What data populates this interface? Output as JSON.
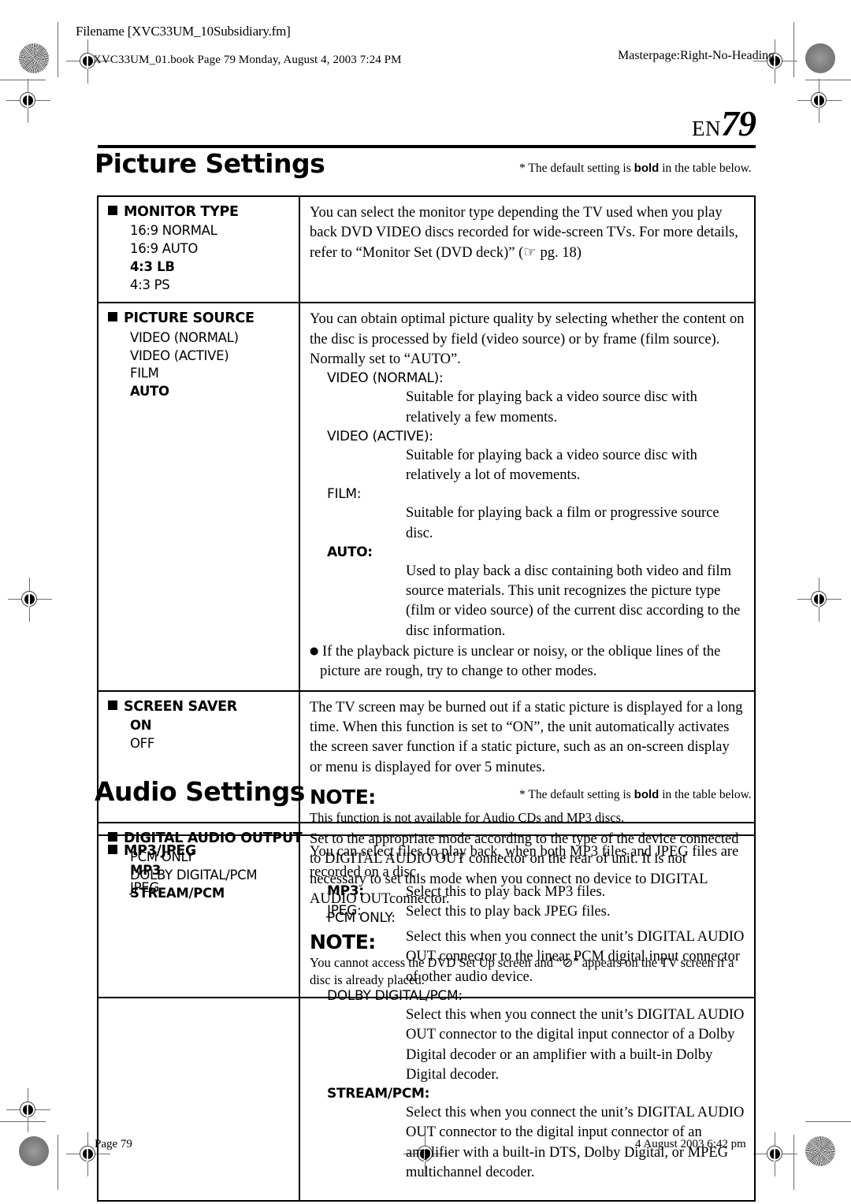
{
  "slugs": {
    "filename": "Filename [XVC33UM_10Subsidiary.fm]",
    "bookline": "XVC33UM_01.book  Page 79  Monday, August 4, 2003  7:24 PM",
    "masterpage": "Masterpage:Right-No-Heading",
    "footer_page": "Page 79",
    "footer_date": "4 August 2003 6:42 pm"
  },
  "header": {
    "locale": "EN",
    "page_number": "79"
  },
  "sections": [
    {
      "id": "picture",
      "title": "Picture Settings",
      "default_note_prefix": "* The default setting is ",
      "default_note_bold": "bold",
      "default_note_suffix": " in the table below."
    },
    {
      "id": "audio",
      "title": "Audio Settings",
      "default_note_prefix": "* The default setting is ",
      "default_note_bold": "bold",
      "default_note_suffix": " in the table below."
    }
  ],
  "picture_table": {
    "monitor_type": {
      "heading": "MONITOR TYPE",
      "options": [
        {
          "label": "16:9 NORMAL",
          "bold": false
        },
        {
          "label": "16:9 AUTO",
          "bold": false
        },
        {
          "label": "4:3 LB",
          "bold": true
        },
        {
          "label": "4:3 PS",
          "bold": false
        }
      ],
      "paragraph": "You can select the monitor type depending the TV used when you play back DVD VIDEO discs recorded for wide-screen TVs. For more details, refer to “Monitor Set (DVD deck)” (☞ pg. 18)"
    },
    "picture_source": {
      "heading": "PICTURE SOURCE",
      "options": [
        {
          "label": "VIDEO (NORMAL)",
          "bold": false
        },
        {
          "label": "VIDEO (ACTIVE)",
          "bold": false
        },
        {
          "label": "FILM",
          "bold": false
        },
        {
          "label": "AUTO",
          "bold": true
        }
      ],
      "paragraph": "You can obtain optimal picture quality by selecting whether the content on the disc is processed by field (video source) or by frame (film source). Normally set to “AUTO”.",
      "definitions": [
        {
          "term": "VIDEO (NORMAL):",
          "bold": false,
          "desc": "Suitable for playing back a video source disc with relatively a few moments."
        },
        {
          "term": "VIDEO (ACTIVE):",
          "bold": false,
          "desc": "Suitable for playing back a video source disc with relatively a lot of movements."
        },
        {
          "term": "FILM:",
          "bold": false,
          "desc": "Suitable for playing back a film or progressive source disc."
        },
        {
          "term": "AUTO:",
          "bold": true,
          "desc": "Used to play back a disc containing both video and film source materials. This unit recognizes the picture type (film or video source) of the current disc according to the disc information."
        }
      ],
      "bullet": "If the playback picture is unclear or noisy, or the oblique lines of the picture are rough, try to change to other modes."
    },
    "screen_saver": {
      "heading": "SCREEN SAVER",
      "options": [
        {
          "label": "ON",
          "bold": true
        },
        {
          "label": "OFF",
          "bold": false
        }
      ],
      "paragraph": "The TV screen may be burned out if a static picture is displayed for a long time. When this function is set to “ON”, the unit automatically activates the screen saver function if a static picture, such as an on-screen display or menu is displayed for over 5 minutes.",
      "note_heading": "NOTE:",
      "note_body": "This function is not available for Audio CDs and MP3 discs."
    },
    "mp3_jpeg": {
      "heading": "MP3/JPEG",
      "options": [
        {
          "label": "MP3",
          "bold": true
        },
        {
          "label": "JPEG",
          "bold": false
        }
      ],
      "paragraph": "You can select files to play back, when both MP3 files and JPEG files are recorded on a disc.",
      "definitions": [
        {
          "term": "MP3:",
          "bold": true,
          "desc": "Select this to play back MP3 files."
        },
        {
          "term": "JPEG:",
          "bold": false,
          "desc": "Select this to play back JPEG files."
        }
      ],
      "note_heading": "NOTE:",
      "note_body": "You cannot access the DVD Set Up screen and “⊘” appears on the TV screen if a disc is already placed."
    }
  },
  "audio_table": {
    "digital_audio_output": {
      "heading": "DIGITAL AUDIO OUTPUT",
      "options": [
        {
          "label": "PCM ONLY",
          "bold": false
        },
        {
          "label": "DOLBY DIGITAL/PCM",
          "bold": false
        },
        {
          "label": "STREAM/PCM",
          "bold": true
        }
      ],
      "paragraph": "Set to the appropriate mode according to the type of the device connected to DIGITAL AUDIO OUT connector on the rear of unit. It is not necessary to set this mode when you connect no device to DIGITAL AUDIO OUTconnector.",
      "definitions": [
        {
          "term": "PCM ONLY:",
          "bold": false,
          "desc": "Select this when you connect the unit’s DIGITAL AUDIO OUT connector to the linear PCM digital input connector of other audio device."
        },
        {
          "term": "DOLBY DIGITAL/PCM:",
          "bold": false,
          "desc": "Select this when you connect the unit’s DIGITAL AUDIO OUT connector to the digital input connector of a Dolby Digital decoder or an amplifier with a built-in Dolby Digital decoder."
        },
        {
          "term": "STREAM/PCM:",
          "bold": true,
          "desc": "Select this when you connect the unit’s DIGITAL AUDIO OUT connector to the digital input connector of an amplifier with a built-in DTS, Dolby Digital, or MPEG multichannel decoder."
        }
      ]
    }
  }
}
